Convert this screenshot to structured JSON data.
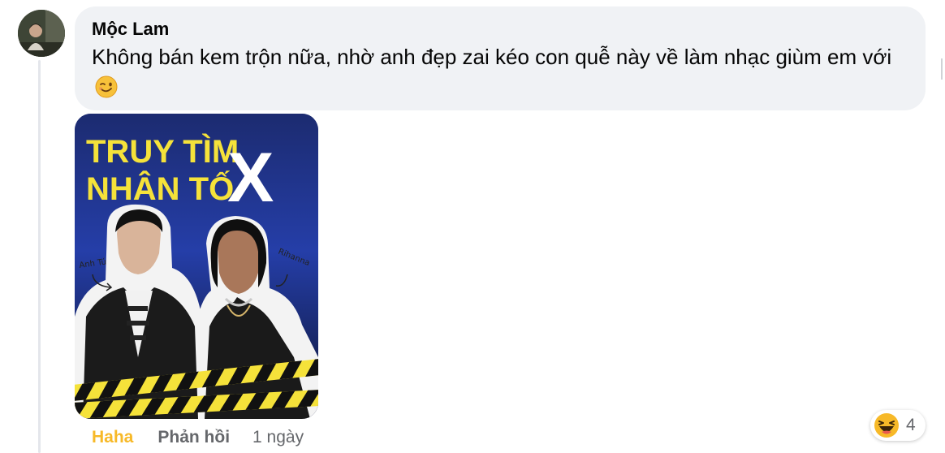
{
  "comment": {
    "author": "Mộc Lam",
    "text": "Không bán kem trộn nữa, nhờ anh đẹp zai kéo con quễ này về làm nhạc giùm em với",
    "emoji": "winking-face",
    "attachment": {
      "title_line1": "TRUY TÌM",
      "title_line2": "NHÂN TỐ",
      "title_big": "X",
      "label_left": "Anh Tú",
      "label_right": "Rihanna"
    },
    "actions": {
      "reaction_label": "Haha",
      "reply_label": "Phản hồi",
      "timestamp": "1 ngày"
    },
    "reactions": {
      "icon": "haha-icon",
      "count": "4"
    }
  },
  "colors": {
    "bubble": "#f0f2f5",
    "haha": "#f7b928",
    "secondary_text": "#65676b",
    "poster_yellow": "#f5e23a"
  }
}
